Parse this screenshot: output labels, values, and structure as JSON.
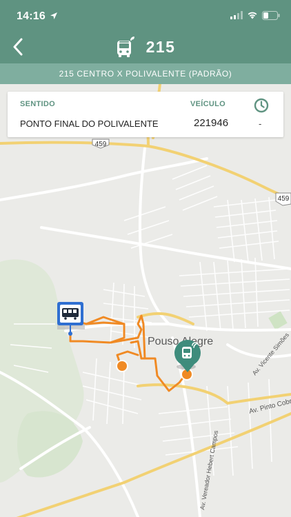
{
  "status_bar": {
    "time": "14:16"
  },
  "header": {
    "title": "215"
  },
  "route_bar": {
    "label": "215 CENTRO X POLIVALENTE (PADRÃO)"
  },
  "card": {
    "col_direction": "SENTIDO",
    "col_vehicle": "VEÍCULO",
    "direction_value": "PONTO FINAL DO POLIVALENTE",
    "vehicle_value": "221946",
    "time_value": "-"
  },
  "map": {
    "city_label": "Pouso Alegre",
    "highway_label_1": "459",
    "highway_label_2": "459",
    "street_label_1": "Av. Pinto Cobra",
    "street_label_2": "Av. Vicente Simões",
    "street_label_3": "Av. Vereador Hebert Campos",
    "route_color": "#f08a24",
    "stop_icon_color": "#2f6fd1",
    "bus_marker_color": "#3e8c7c"
  }
}
